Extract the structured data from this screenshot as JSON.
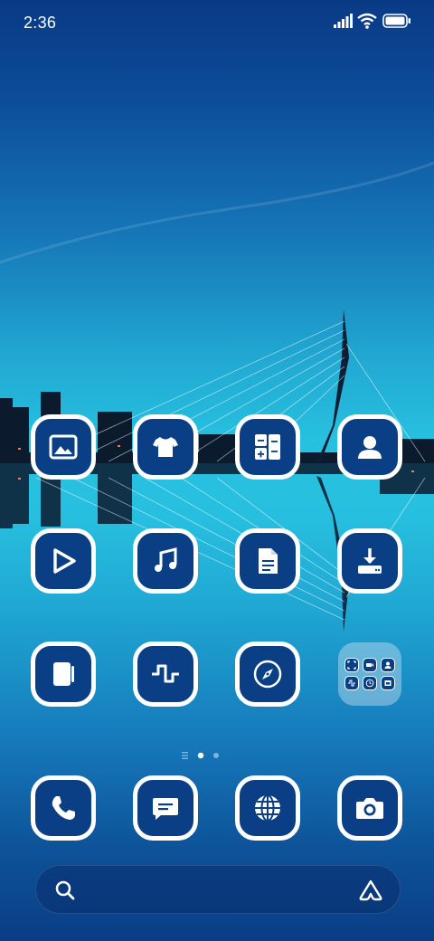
{
  "status_bar": {
    "time": "2:36",
    "signal_icon": "cellular-signal-icon",
    "wifi_icon": "wifi-icon",
    "battery_icon": "battery-icon"
  },
  "home_grid": {
    "rows": [
      [
        "gallery-icon",
        "themes-icon",
        "calculator-icon",
        "contacts-icon"
      ],
      [
        "video-player-icon",
        "music-icon",
        "notes-icon",
        "downloads-icon"
      ],
      [
        "notebook-icon",
        "recorder-icon",
        "compass-icon",
        "folder-icon"
      ]
    ],
    "folder_contents": [
      "scanner-icon",
      "video-icon",
      "user-icon",
      "wave-icon",
      "clock-icon",
      "file-manager-icon"
    ]
  },
  "page_indicator": {
    "pages": 2,
    "active": 0
  },
  "dock": [
    "phone-icon",
    "messages-icon",
    "browser-icon",
    "camera-icon"
  ],
  "search": {
    "search_icon": "search-icon",
    "assistant_icon": "assistant-icon"
  },
  "colors": {
    "icon_fill": "#0b3f85",
    "icon_border": "#ffffff"
  }
}
